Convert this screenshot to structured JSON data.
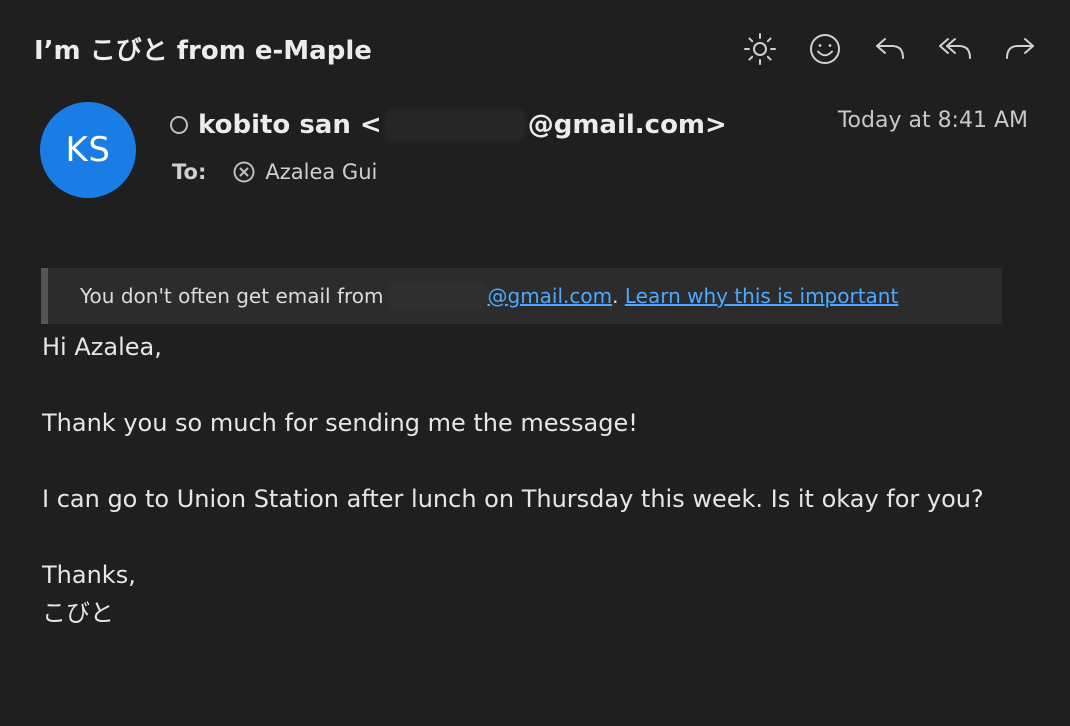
{
  "email": {
    "subject": "I’m こびと from e-Maple",
    "sender": {
      "initials": "KS",
      "name_prefix": "kobito san <",
      "email_suffix": "@gmail.com>"
    },
    "timestamp": "Today at 8:41 AM",
    "to_label": "To:",
    "recipient": "Azalea Gui",
    "banner": {
      "text": "You don't often get email from",
      "email_suffix": "@gmail.com",
      "separator": ".",
      "link": "Learn why this is important"
    },
    "body": {
      "greeting": "Hi Azalea,",
      "line1": "Thank you so much for sending me the message!",
      "line2": "I can go to Union Station after lunch on Thursday this week.  Is it okay for you?",
      "closing": "Thanks,",
      "signature": "こびと"
    }
  },
  "toolbar": {
    "icons": [
      "brightness-icon",
      "emoji-icon",
      "reply-icon",
      "reply-all-icon",
      "forward-icon"
    ]
  },
  "colors": {
    "background": "#1f1f1f",
    "avatar": "#1a7de6",
    "link": "#4fa8ff",
    "banner_bg": "#2c2c2c"
  }
}
